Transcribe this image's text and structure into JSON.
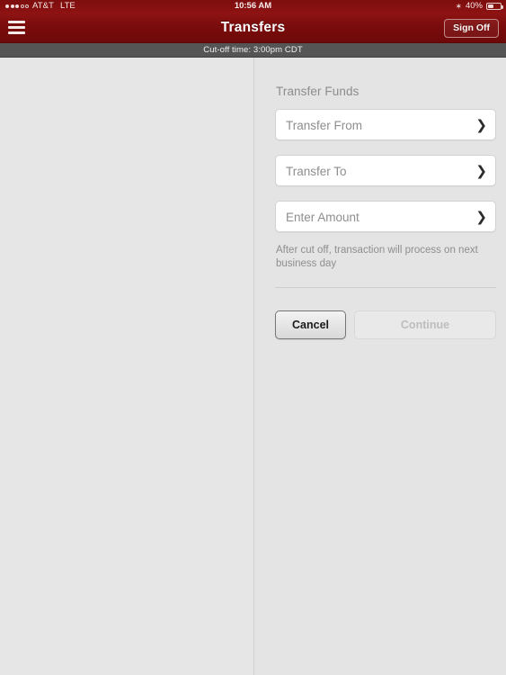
{
  "status_bar": {
    "signal_dots_filled": 3,
    "signal_dots_empty": 2,
    "carrier": "AT&T",
    "network": "LTE",
    "time": "10:56 AM",
    "bluetooth_icon": "bluetooth-icon",
    "battery_percent": "40%",
    "battery_level": 40
  },
  "navbar": {
    "menu_icon": "hamburger-menu-icon",
    "title": "Transfers",
    "sign_off_label": "Sign Off",
    "background_color": "#7a0c0c"
  },
  "cutoff_bar": {
    "text": "Cut-off time: 3:00pm CDT",
    "background_color": "#555555"
  },
  "main": {
    "section_title": "Transfer Funds",
    "fields": [
      {
        "label": "Transfer From",
        "value": "",
        "chevron_icon": "chevron-right-icon"
      },
      {
        "label": "Transfer To",
        "value": "",
        "chevron_icon": "chevron-right-icon"
      },
      {
        "label": "Enter Amount",
        "value": "",
        "chevron_icon": "chevron-right-icon"
      }
    ],
    "helper_text": "After cut off, transaction will process on next business day",
    "buttons": {
      "cancel_label": "Cancel",
      "continue_label": "Continue",
      "continue_disabled": true
    }
  }
}
